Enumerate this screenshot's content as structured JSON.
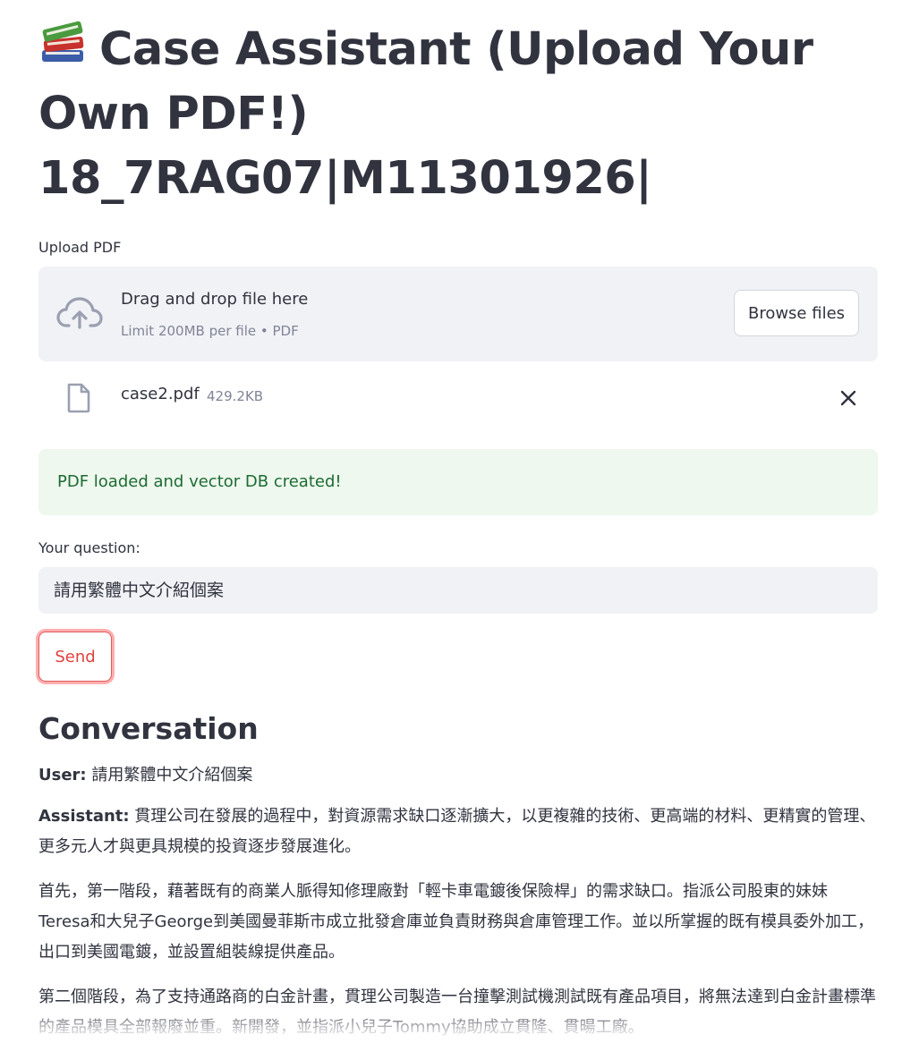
{
  "header": {
    "emoji_icon": "books-icon",
    "title": "Case Assistant (Upload Your Own PDF!) 18_7RAG07|M11301926|"
  },
  "uploader": {
    "label": "Upload PDF",
    "icon": "cloud-upload-icon",
    "drop_text": "Drag and drop file here",
    "limit_text": "Limit 200MB per file • PDF",
    "browse_label": "Browse files"
  },
  "uploaded_file": {
    "icon": "file-icon",
    "name": "case2.pdf",
    "size": "429.2KB",
    "remove_icon": "close-icon"
  },
  "status": {
    "message": "PDF loaded and vector DB created!",
    "color": "#1d6b33"
  },
  "question": {
    "label": "Your question:",
    "value": "請用繁體中文介紹個案"
  },
  "send_label": "Send",
  "conversation": {
    "title": "Conversation",
    "user_prefix": "User:",
    "user_text": " 請用繁體中文介紹個案",
    "assistant_prefix": "Assistant:",
    "assistant_paragraphs": [
      " 貫理公司在發展的過程中，對資源需求缺口逐漸擴大，以更複雜的技術、更高端的材料、更精實的管理、更多元人才與更具規模的投資逐步發展進化。",
      "首先，第一階段，藉著既有的商業人脈得知修理廠對「輕卡車電鍍後保險桿」的需求缺口。指派公司股東的妹妹Teresa和大兒子George到美國曼菲斯市成立批發倉庫並負責財務與倉庫管理工作。並以所掌握的既有模具委外加工，出口到美國電鍍，並設置組裝線提供產品。",
      "第二個階段，為了支持通路商的白金計畫，貫理公司製造一台撞擊測試機測試既有產品項目，將無法達到白金計畫標準的產品模具全部報廢並重。新開發，並指派小兒子Tommy協助成立貫隆、貫暘工廠。"
    ]
  },
  "colors": {
    "accent": "#ff4b4b",
    "panel": "#f0f2f6",
    "success_bg": "#eef8ee"
  }
}
